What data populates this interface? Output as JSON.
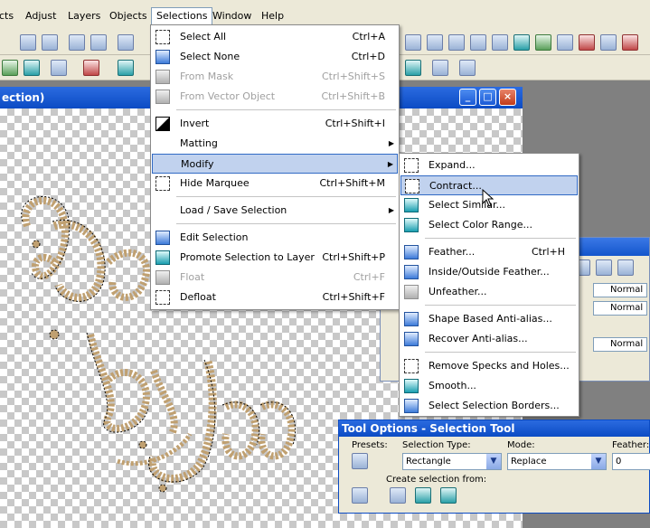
{
  "menubar": {
    "items": [
      "cts",
      "Adjust",
      "Layers",
      "Objects",
      "Selections",
      "Window",
      "Help"
    ]
  },
  "canvas": {
    "title": "ection)"
  },
  "selections_menu": {
    "items": [
      {
        "label": "Select All",
        "shortcut": "Ctrl+A",
        "enabled": true
      },
      {
        "label": "Select None",
        "shortcut": "Ctrl+D",
        "enabled": true
      },
      {
        "label": "From Mask",
        "shortcut": "Ctrl+Shift+S",
        "enabled": false
      },
      {
        "label": "From Vector Object",
        "shortcut": "Ctrl+Shift+B",
        "enabled": false
      },
      {
        "label": "Invert",
        "shortcut": "Ctrl+Shift+I",
        "enabled": true
      },
      {
        "label": "Matting",
        "shortcut": "",
        "enabled": true
      },
      {
        "label": "Modify",
        "shortcut": "",
        "enabled": true
      },
      {
        "label": "Hide Marquee",
        "shortcut": "Ctrl+Shift+M",
        "enabled": true
      },
      {
        "label": "Load / Save Selection",
        "shortcut": "",
        "enabled": true
      },
      {
        "label": "Edit Selection",
        "shortcut": "",
        "enabled": true
      },
      {
        "label": "Promote Selection to Layer",
        "shortcut": "Ctrl+Shift+P",
        "enabled": true
      },
      {
        "label": "Float",
        "shortcut": "Ctrl+F",
        "enabled": false
      },
      {
        "label": "Defloat",
        "shortcut": "Ctrl+Shift+F",
        "enabled": true
      }
    ]
  },
  "modify_menu": {
    "items": [
      {
        "label": "Expand...",
        "shortcut": ""
      },
      {
        "label": "Contract...",
        "shortcut": ""
      },
      {
        "label": "Select Similar...",
        "shortcut": ""
      },
      {
        "label": "Select Color Range...",
        "shortcut": ""
      },
      {
        "label": "Feather...",
        "shortcut": "Ctrl+H"
      },
      {
        "label": "Inside/Outside Feather...",
        "shortcut": ""
      },
      {
        "label": "Unfeather...",
        "shortcut": ""
      },
      {
        "label": "Shape Based Anti-alias...",
        "shortcut": ""
      },
      {
        "label": "Recover Anti-alias...",
        "shortcut": ""
      },
      {
        "label": "Remove Specks and Holes...",
        "shortcut": ""
      },
      {
        "label": "Smooth...",
        "shortcut": ""
      },
      {
        "label": "Select Selection Borders...",
        "shortcut": ""
      }
    ]
  },
  "layers": {
    "blend_modes": [
      "Normal",
      "Normal",
      "Normal"
    ]
  },
  "tool_options": {
    "title": "Tool Options - Selection Tool",
    "presets_label": "Presets:",
    "selection_type_label": "Selection Type:",
    "selection_type_value": "Rectangle",
    "mode_label": "Mode:",
    "mode_value": "Replace",
    "feather_label": "Feather:",
    "feather_value": "0",
    "create_label": "Create selection from:"
  },
  "colors": {
    "titlebar": "#0b4bc4",
    "highlight": "#c1d2ee",
    "menu_bg": "#ece9d8"
  }
}
